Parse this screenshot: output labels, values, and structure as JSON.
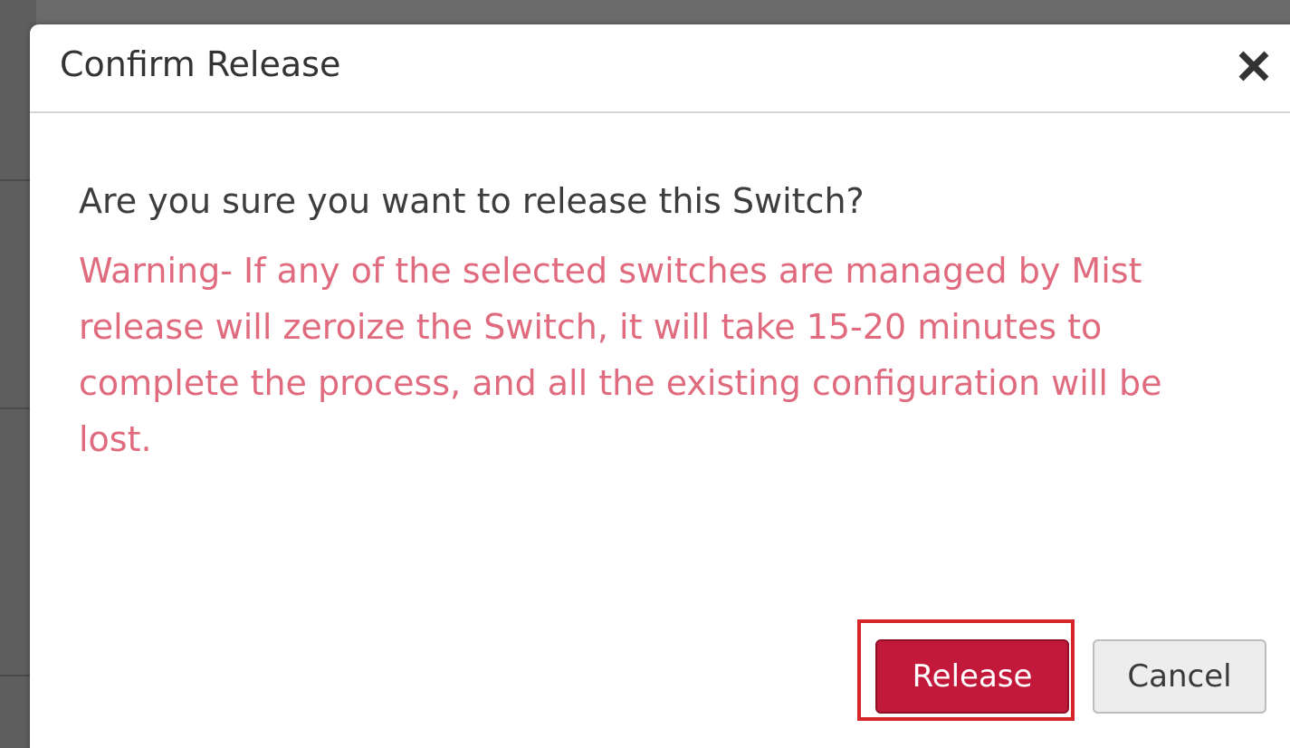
{
  "dialog": {
    "title": "Confirm Release",
    "close_icon": "close-icon",
    "question": "Are you sure you want to release this Switch?",
    "warning": "Warning- If any of the selected switches are managed by Mist release will zeroize the Switch, it will take 15-20 minutes to complete the process, and all the existing configuration will be lost.",
    "buttons": {
      "release_label": "Release",
      "cancel_label": "Cancel"
    }
  },
  "colors": {
    "release_button": "#c2183a",
    "warning_text": "#e06a7e",
    "highlight_border": "#d6262c"
  }
}
